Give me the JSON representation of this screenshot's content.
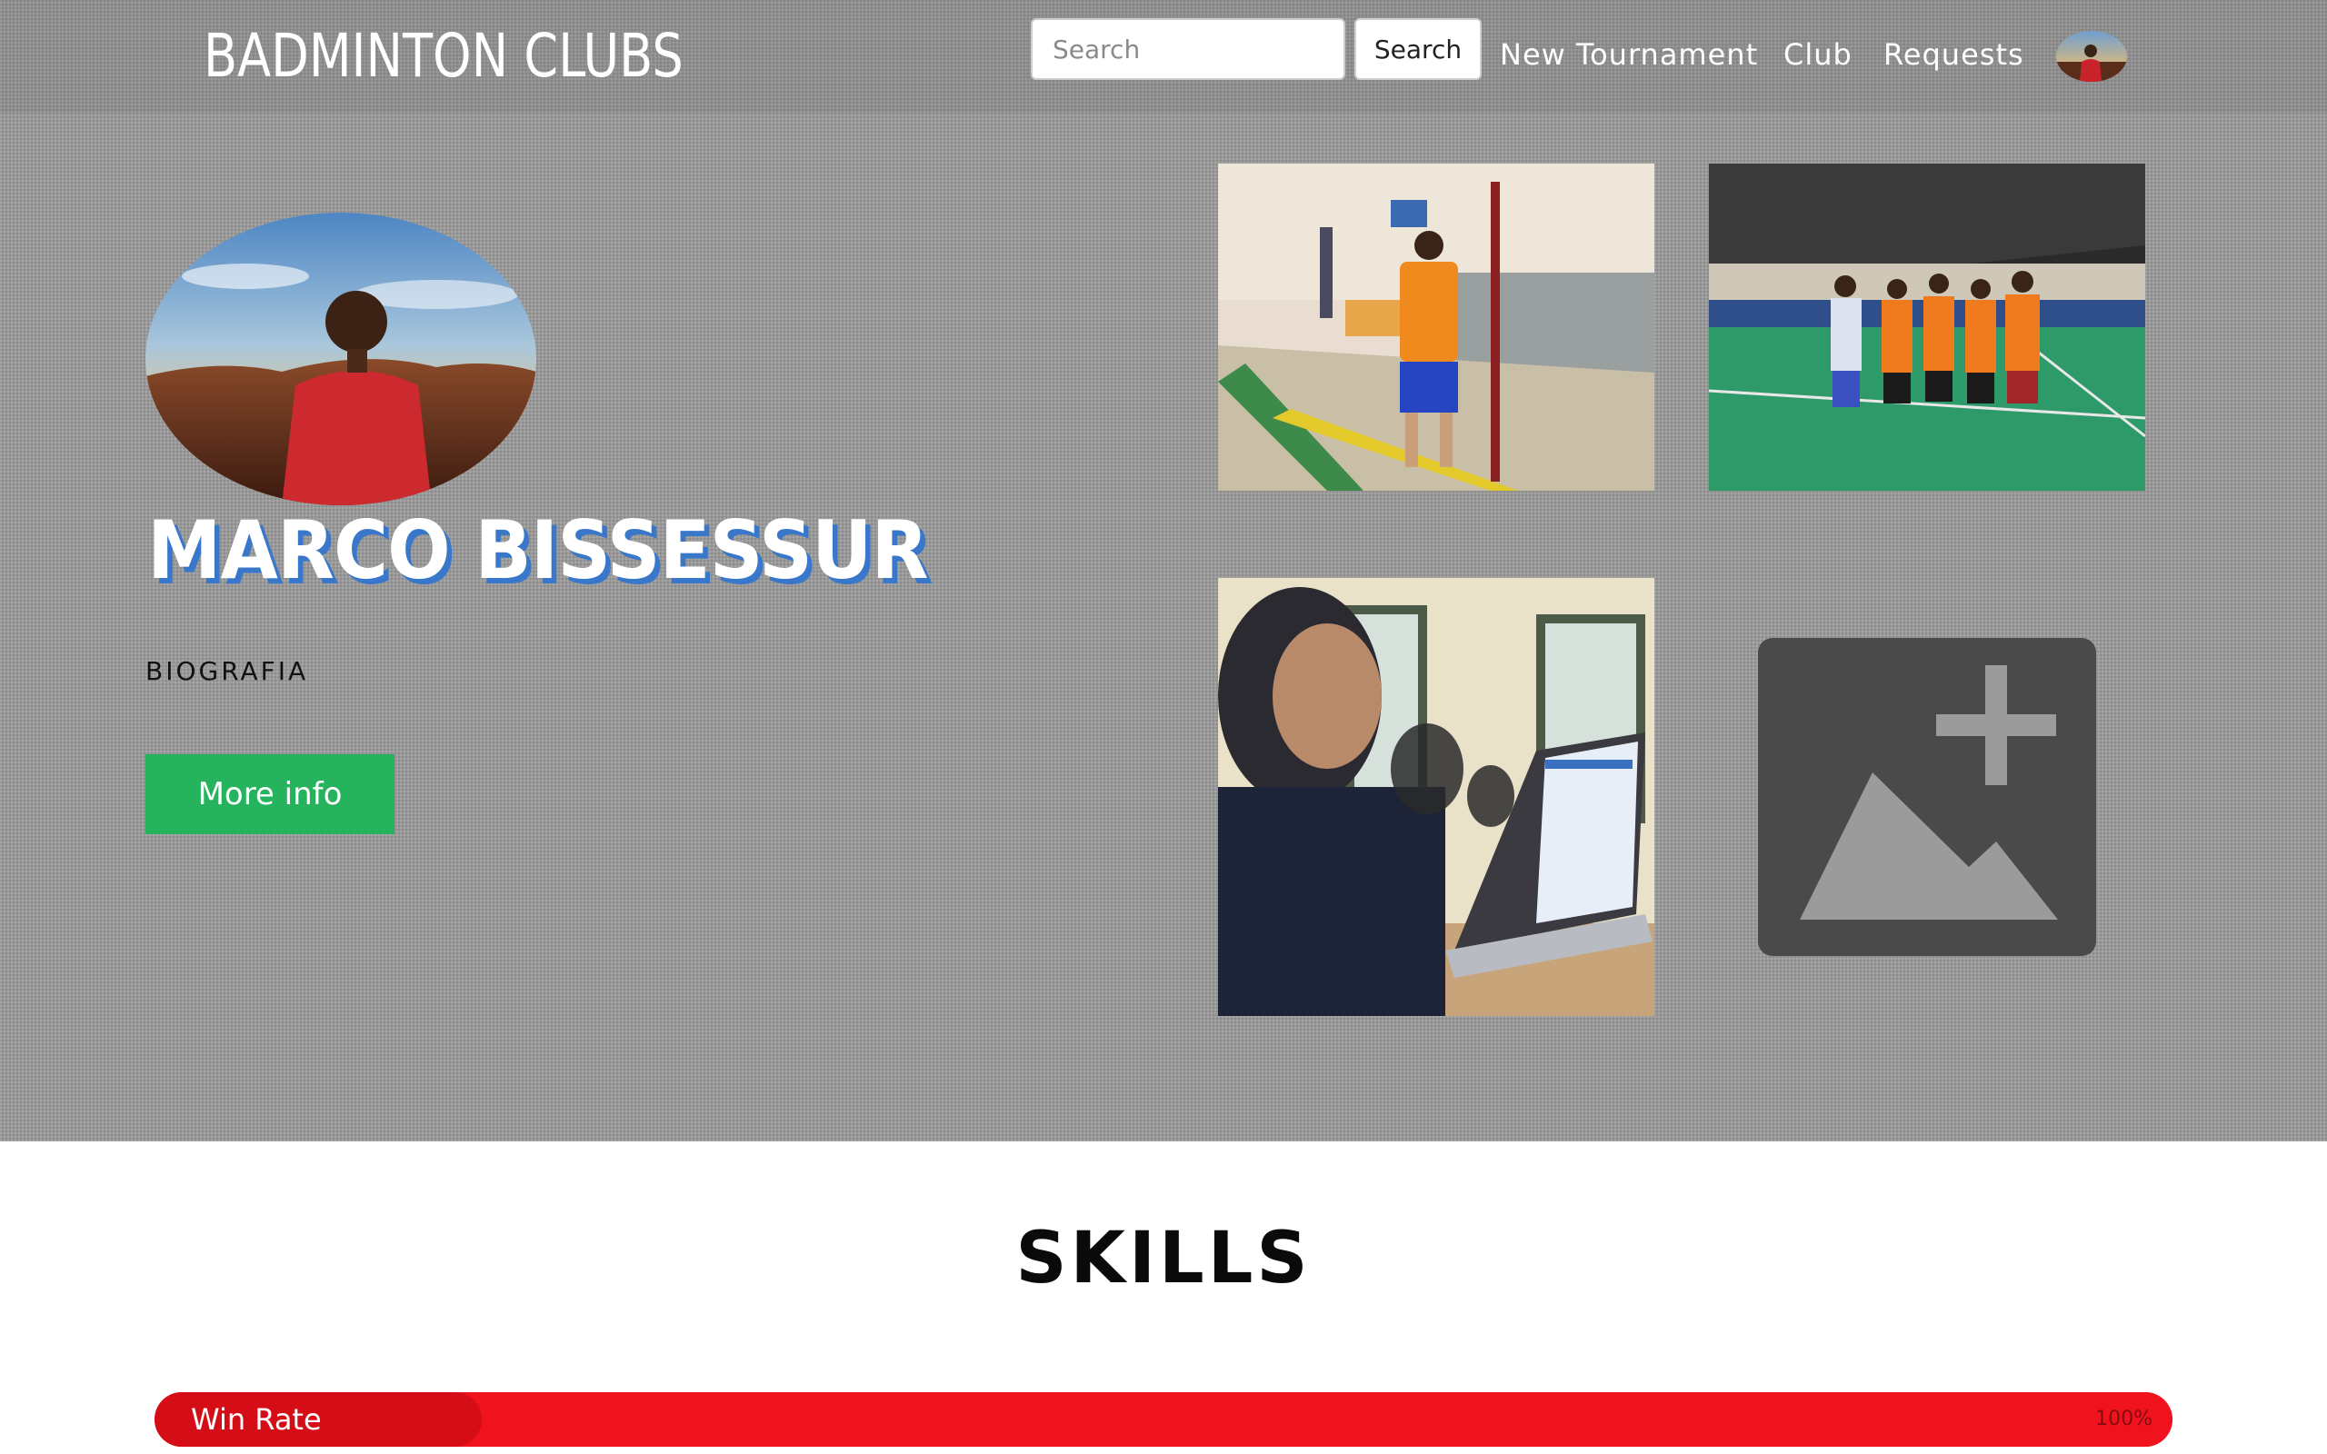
{
  "header": {
    "brand": "BADMINTON CLUBS",
    "search": {
      "placeholder": "Search",
      "button_label": "Search"
    },
    "nav": {
      "new_tournament": "New Tournament",
      "club": "Club",
      "requests": "Requests"
    }
  },
  "profile": {
    "name": "MARCO BISSESSUR",
    "bio_label": "BIOGRAFIA",
    "more_info_label": "More info"
  },
  "gallery": {
    "photos": [
      "trophy-photo",
      "team-photo",
      "laptop-photo"
    ],
    "add_photo_icon": "add-photo-icon"
  },
  "skills": {
    "title": "SKILLS",
    "items": [
      {
        "label": "Win Rate",
        "percent_text": "100%",
        "value": 1.0
      }
    ]
  },
  "colors": {
    "accent_green": "#25b35d",
    "name_shadow_blue": "#3877c9",
    "skill_bar_red": "#f0131e"
  }
}
